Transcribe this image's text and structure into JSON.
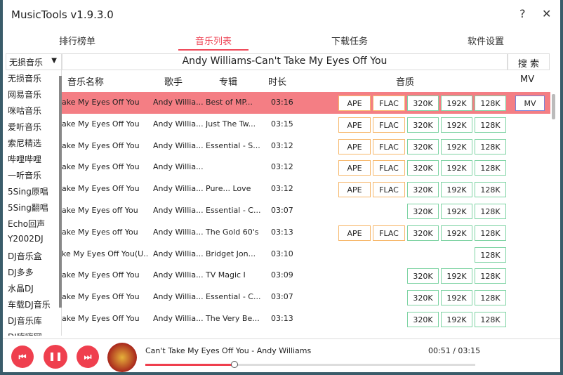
{
  "app": {
    "title": "MusicTools v1.9.3.0",
    "help": "?",
    "close": "✕"
  },
  "tabs": [
    {
      "label": "排行榜单"
    },
    {
      "label": "音乐列表"
    },
    {
      "label": "下载任务"
    },
    {
      "label": "软件设置"
    }
  ],
  "source_select": {
    "value": "无损音乐"
  },
  "search": {
    "value": "Andy Williams-Can't Take My Eyes Off You",
    "button": "搜 索"
  },
  "sources": [
    "无损音乐",
    "网易音乐",
    "咪咕音乐",
    "爱听音乐",
    "索尼精选",
    "哔哩哔哩",
    "一听音乐",
    "5Sing原唱",
    "5Sing翻唱",
    "Echo回声",
    "Y2002DJ",
    "DJ音乐盒",
    "DJ多多",
    "水晶DJ",
    "车载DJ音乐",
    "DJ音乐库",
    "DJ嗨嗨网"
  ],
  "columns": {
    "name": "音乐名称",
    "artist": "歌手",
    "album": "专辑",
    "duration": "时长",
    "quality": "音质",
    "mv": "MV"
  },
  "rows": [
    {
      "name": "ake My Eyes Off You",
      "artist": "Andy Willia...",
      "album": "Best of MP...",
      "duration": "03:16",
      "q": [
        "APE",
        "FLAC",
        "320K",
        "192K",
        "128K"
      ],
      "mv": "MV"
    },
    {
      "name": "ake My Eyes Off You",
      "artist": "Andy Willia...",
      "album": "Just The Tw...",
      "duration": "03:15",
      "q": [
        "APE",
        "FLAC",
        "320K",
        "192K",
        "128K"
      ]
    },
    {
      "name": "ake My Eyes Off You",
      "artist": "Andy Willia...",
      "album": "Essential - S...",
      "duration": "03:12",
      "q": [
        "APE",
        "FLAC",
        "320K",
        "192K",
        "128K"
      ]
    },
    {
      "name": "ake My Eyes Off You",
      "artist": "Andy Willia...",
      "album": "",
      "duration": "03:12",
      "q": [
        "APE",
        "FLAC",
        "320K",
        "192K",
        "128K"
      ]
    },
    {
      "name": "ake My Eyes Off You",
      "artist": "Andy Willia...",
      "album": "Pure... Love",
      "duration": "03:12",
      "q": [
        "APE",
        "FLAC",
        "320K",
        "192K",
        "128K"
      ]
    },
    {
      "name": "ake My Eyes off You",
      "artist": "Andy Willia...",
      "album": "Essential - C...",
      "duration": "03:07",
      "q": [
        "",
        "",
        "320K",
        "192K",
        "128K"
      ]
    },
    {
      "name": "ake My Eyes off You",
      "artist": "Andy Willia...",
      "album": "The Gold 60's",
      "duration": "03:13",
      "q": [
        "APE",
        "FLAC",
        "320K",
        "192K",
        "128K"
      ]
    },
    {
      "name": "ke My Eyes Off You(U...",
      "artist": "Andy Willia...",
      "album": "Bridget Jon...",
      "duration": "03:10",
      "q": [
        "",
        "",
        "",
        "",
        "128K"
      ]
    },
    {
      "name": "ake My Eyes Off You",
      "artist": "Andy Willia...",
      "album": "TV Magic I",
      "duration": "03:09",
      "q": [
        "",
        "",
        "320K",
        "192K",
        "128K"
      ]
    },
    {
      "name": "ake My Eyes Off You",
      "artist": "Andy Willia...",
      "album": "Essential - C...",
      "duration": "03:07",
      "q": [
        "",
        "",
        "320K",
        "192K",
        "128K"
      ]
    },
    {
      "name": "ake My Eyes Off You",
      "artist": "Andy Willia...",
      "album": "The Very Be...",
      "duration": "03:13",
      "q": [
        "",
        "",
        "320K",
        "192K",
        "128K"
      ]
    }
  ],
  "player": {
    "song": "Can't Take My Eyes Off You - Andy Williams",
    "time": "00:51 / 03:15",
    "progress": 0.27
  }
}
